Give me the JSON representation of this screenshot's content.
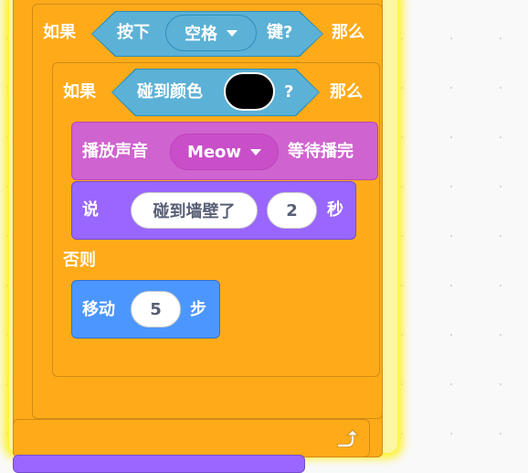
{
  "outer_if": {
    "if_label": "如果",
    "then_label": "那么"
  },
  "key_sensor": {
    "press_label": "按下",
    "key_value": "空格",
    "key_suffix": "键?"
  },
  "inner_if_else": {
    "if_label": "如果",
    "then_label": "那么",
    "else_label": "否则"
  },
  "color_sensor": {
    "touch_label": "碰到颜色",
    "question": "?",
    "color": "#000000"
  },
  "play_sound": {
    "label_left": "播放声音",
    "sound_value": "Meow",
    "label_right": "等待播完"
  },
  "say_for": {
    "say_label": "说",
    "message": "碰到墙壁了",
    "seconds": "2",
    "seconds_label": "秒"
  },
  "move_steps": {
    "move_label": "移动",
    "steps": "5",
    "steps_label": "步"
  },
  "colors": {
    "control": "#ffab19",
    "sensing": "#5cb1d6",
    "sound": "#cf63cf",
    "looks": "#9966ff",
    "motion": "#4c97ff",
    "glow": "#fff100"
  },
  "icons": {
    "loop_arrow": "loop-arrow-icon",
    "dropdown": "caret-down-icon"
  }
}
